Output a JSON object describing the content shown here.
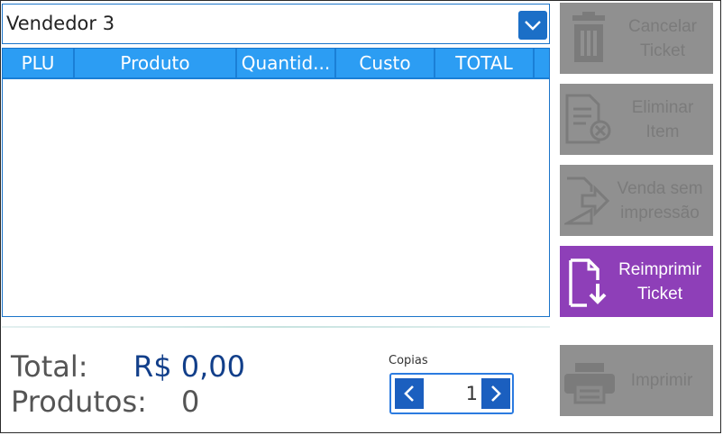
{
  "vendor_select": {
    "value": "Vendedor 3"
  },
  "table": {
    "columns": [
      "PLU",
      "Produto",
      "Quantid...",
      "Custo",
      "TOTAL"
    ],
    "rows": []
  },
  "side_buttons": {
    "cancel_ticket": {
      "line1": "Cancelar",
      "line2": "Ticket",
      "icon": "trash-icon",
      "enabled": false
    },
    "delete_item": {
      "line1": "Eliminar",
      "line2": "Item",
      "icon": "document-delete-icon",
      "enabled": false
    },
    "sale_no_print": {
      "line1": "Venda sem",
      "line2": "impressão",
      "icon": "document-export-icon",
      "enabled": false
    },
    "reprint_ticket": {
      "line1": "Reimprimir",
      "line2": "Ticket",
      "icon": "document-download-icon",
      "enabled": true
    },
    "print": {
      "label": "Imprimir",
      "icon": "printer-icon",
      "enabled": false
    }
  },
  "summary": {
    "total_label": "Total:",
    "total_value": "R$ 0,00",
    "products_label": "Produtos:",
    "products_value": "0"
  },
  "copies": {
    "label": "Copias",
    "value": "1"
  },
  "colors": {
    "accent_blue": "#2c9df3",
    "dark_blue": "#1b5fbf",
    "disabled_gray": "#909090",
    "purple": "#8e3fb8",
    "total_value_blue": "#123f8a"
  }
}
